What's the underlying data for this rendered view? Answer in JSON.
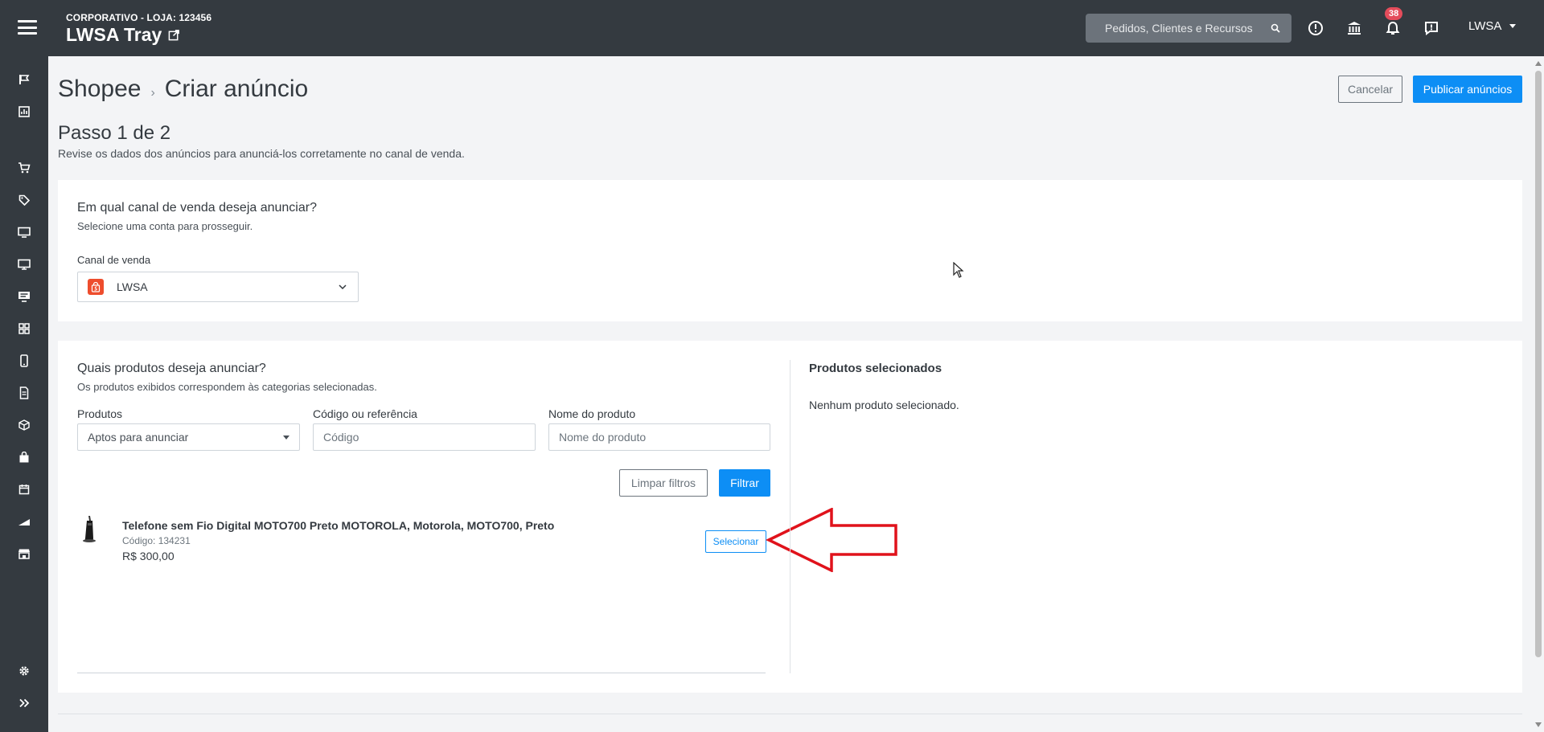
{
  "header": {
    "store_sub": "CORPORATIVO - LOJA: 123456",
    "store_name": "LWSA Tray",
    "search_placeholder": "Pedidos, Clientes e Recursos",
    "notifications_count": "38",
    "user_label": "LWSA"
  },
  "page": {
    "breadcrumb_parent": "Shopee",
    "breadcrumb_sep": "›",
    "title": "Criar anúncio",
    "cancel_label": "Cancelar",
    "publish_label": "Publicar anúncios",
    "step_title": "Passo 1 de 2",
    "step_desc": "Revise os dados dos anúncios para anunciá-los corretamente no canal de venda."
  },
  "channel_card": {
    "question": "Em qual canal de venda deseja anunciar?",
    "subtitle": "Selecione uma conta para prosseguir.",
    "field_label": "Canal de venda",
    "selected_value": "LWSA"
  },
  "products_card": {
    "question": "Quais produtos deseja anunciar?",
    "subtitle": "Os produtos exibidos correspondem às categorias selecionadas.",
    "filters": {
      "products_label": "Produtos",
      "products_value": "Aptos para anunciar",
      "code_label": "Código ou referência",
      "code_placeholder": "Código",
      "name_label": "Nome do produto",
      "name_placeholder": "Nome do produto",
      "clear_label": "Limpar filtros",
      "filter_label": "Filtrar"
    },
    "items": [
      {
        "name": "Telefone sem Fio Digital MOTO700 Preto MOTOROLA, Motorola, MOTO700, Preto",
        "code": "Código: 134231",
        "price": "R$ 300,00",
        "select_label": "Selecionar"
      }
    ],
    "selected_title": "Produtos selecionados",
    "selected_empty": "Nenhum produto selecionado."
  },
  "colors": {
    "topbar": "#343a40",
    "primary": "#0d8ef5",
    "badge": "#e44c5b",
    "shopee": "#ee4d2d",
    "annotation_arrow": "#e0121b"
  }
}
